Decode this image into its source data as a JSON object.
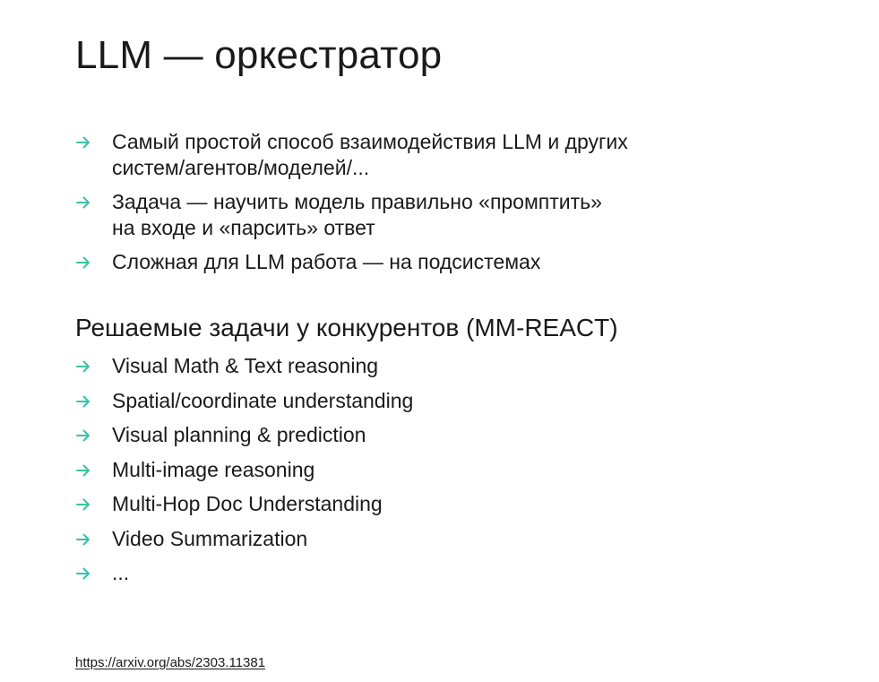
{
  "slide": {
    "title": "LLM — оркестратор",
    "bullets_main": [
      {
        "line1": "Самый простой способ взаимодействия LLM и других",
        "line2": "систем/агентов/моделей/..."
      },
      {
        "line1": "Задача — научить модель правильно «промптить»",
        "line2": "на входе и «парсить» ответ"
      },
      {
        "line1": "Сложная для LLM работа — на подсистемах",
        "line2": ""
      }
    ],
    "subtitle": "Решаемые задачи у конкурентов (MM-REACT)",
    "bullets_tasks": [
      "Visual Math & Text reasoning",
      "Spatial/coordinate understanding",
      "Visual planning & prediction",
      "Multi-image reasoning",
      "Multi-Hop Doc Understanding",
      "Video Summarization",
      "..."
    ],
    "source_link": "https://arxiv.org/abs/2303.11381"
  },
  "colors": {
    "accent": "#3cc0a8",
    "text": "#1a1a1a",
    "background": "#ffffff"
  },
  "icons": {
    "bullet": "arrow-right-icon"
  }
}
